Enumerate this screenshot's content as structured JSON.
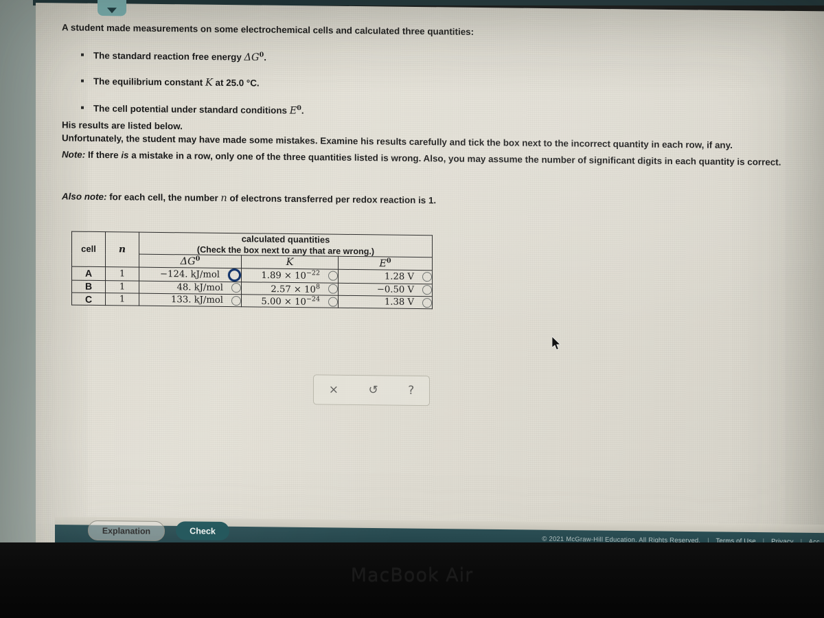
{
  "device": {
    "brand_label": "MacBook Air"
  },
  "tab": {
    "icon": "chevron-down-icon"
  },
  "prose": {
    "intro": "A student made measurements on some electrochemical cells and calculated three quantities:",
    "bullets": [
      {
        "pre": "The standard reaction free energy ",
        "symbol": "ΔG",
        "sup": "0",
        "post": "."
      },
      {
        "pre": "The equilibrium constant ",
        "symbol": "K",
        "sup": "",
        "post": " at 25.0 °C."
      },
      {
        "pre": "The cell potential under standard conditions ",
        "symbol": "E",
        "sup": "0",
        "post": "."
      }
    ],
    "his_results": "His results are listed below.",
    "unfortunately": "Unfortunately, the student may have made some mistakes. Examine his results carefully and tick the box next to the incorrect quantity in each row, if any.",
    "note_label": "Note:",
    "note_body": " If there ",
    "note_italic": "is",
    "note_rest": " a mistake in a row, only one of the three quantities listed is wrong. Also, you may assume the number of significant digits in each quantity is correct.",
    "also_label": "Also note:",
    "also_body": " for each cell, the number ",
    "also_symbol": "n",
    "also_rest": " of electrons transferred per redox reaction is 1."
  },
  "table": {
    "group_header": "calculated quantities",
    "group_subheader": "(Check the box next to any that are wrong.)",
    "col_cell": "cell",
    "col_n": "n",
    "columns": [
      {
        "symbol": "ΔG",
        "sup": "0"
      },
      {
        "symbol": "K",
        "sup": ""
      },
      {
        "symbol": "E",
        "sup": "0"
      }
    ],
    "rows": [
      {
        "cell": "A",
        "n": "1",
        "dg": {
          "value": "−124. kJ/mol",
          "checked": false,
          "focused": true
        },
        "k": {
          "mantissa": "1.89 × 10",
          "exponent": "−22",
          "checked": false,
          "focused": false
        },
        "e": {
          "value": "1.28 V",
          "checked": false,
          "focused": false
        }
      },
      {
        "cell": "B",
        "n": "1",
        "dg": {
          "value": "48. kJ/mol",
          "checked": false,
          "focused": false
        },
        "k": {
          "mantissa": "2.57 × 10",
          "exponent": "8",
          "checked": false,
          "focused": false
        },
        "e": {
          "value": "−0.50 V",
          "checked": false,
          "focused": false
        }
      },
      {
        "cell": "C",
        "n": "1",
        "dg": {
          "value": "133. kJ/mol",
          "checked": false,
          "focused": false
        },
        "k": {
          "mantissa": "5.00 × 10",
          "exponent": "−24",
          "checked": false,
          "focused": false
        },
        "e": {
          "value": "1.38 V",
          "checked": false,
          "focused": false
        }
      }
    ]
  },
  "minibar": {
    "clear": "×",
    "undo": "↺",
    "help": "?"
  },
  "actions": {
    "explanation": "Explanation",
    "check": "Check"
  },
  "footer": {
    "copyright": "© 2021 McGraw-Hill Education. All Rights Reserved.",
    "links": [
      "Terms of Use",
      "Privacy",
      "Acc"
    ],
    "separator": "|"
  },
  "colors": {
    "brand_teal": "#1f5459",
    "tab_teal": "#79aeae",
    "focus_blue": "#12346b",
    "page": "#e0ddd3"
  }
}
